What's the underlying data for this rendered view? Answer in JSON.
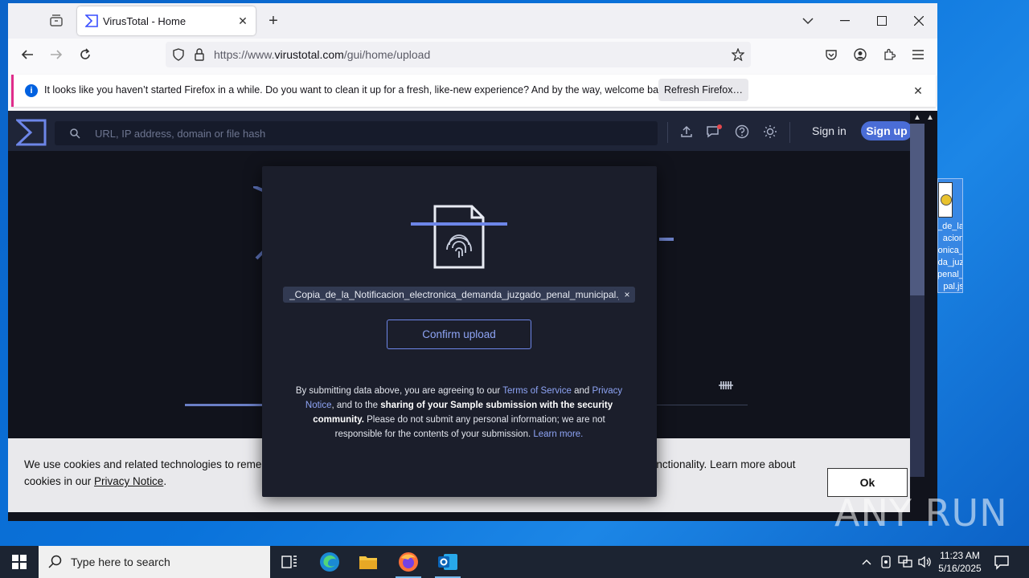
{
  "browser": {
    "tab_title": "VirusTotal - Home",
    "url_prefix": "https://www.",
    "url_domain": "virustotal.com",
    "url_path": "/gui/home/upload",
    "notification": {
      "text": "It looks like you haven’t started Firefox in a while. Do you want to clean it up for a fresh, like-new experience? And by the way, welcome back!",
      "button": "Refresh Firefox…"
    }
  },
  "vt": {
    "search_placeholder": "URL, IP address, domain or file hash",
    "sign_in": "Sign in",
    "sign_up": "Sign up"
  },
  "modal": {
    "file_name": "_Copia_de_la_Notificacion_electronica_demanda_juzgado_penal_municipal.js",
    "remove_glyph": "×",
    "confirm_label": "Confirm upload",
    "terms_1": "By submitting data above, you are agreeing to our ",
    "terms_link_tos": "Terms of Service",
    "terms_and": " and ",
    "terms_link_privacy": "Privacy Notice",
    "terms_2": ", and to the ",
    "terms_bold": "sharing of your Sample submission with the security community.",
    "terms_3": " Please do not submit any personal information; we are not responsible for the contents of your submission. ",
    "terms_learn": "Learn more."
  },
  "cookie": {
    "text_start": "We use cookies and related technologies to remember user preferences, for security, to analyse our traffic, and to enable website functionality. Learn more about cookies in our ",
    "privacy_link": "Privacy Notice",
    "text_end": ".",
    "ok_label": "Ok"
  },
  "desktop_icon_label": "_Copia_de_la_Notificacion_electronica_demanda_juzgado_penal_municipal.js",
  "watermark": "ANY RUN",
  "taskbar": {
    "search_placeholder": "Type here to search",
    "time": "11:23 AM",
    "date": "5/16/2025"
  },
  "colors": {
    "vt_accent": "#4a6dd6",
    "vt_bg": "#11131c",
    "firefox_notice_accent": "#e02d8b"
  }
}
